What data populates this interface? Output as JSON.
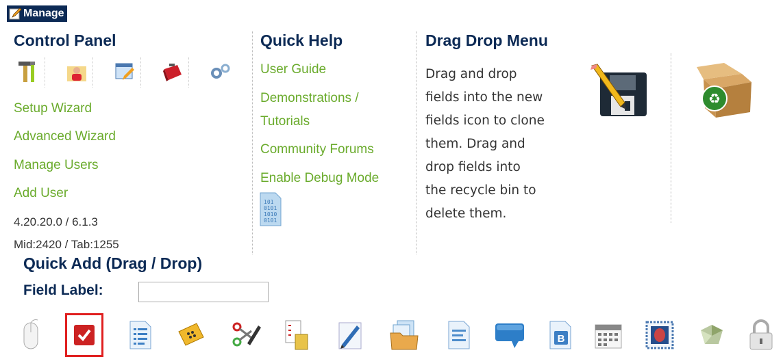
{
  "header": {
    "title": "Manage"
  },
  "control_panel": {
    "title": "Control Panel",
    "icons": [
      "tools-icon",
      "user-folder-icon",
      "window-edit-icon",
      "toolbox-icon",
      "gears-icon"
    ],
    "links": [
      "Setup Wizard",
      "Advanced Wizard",
      "Manage Users",
      "Add User"
    ],
    "version": "4.20.20.0 / 6.1.3",
    "ids": "Mid:2420 / Tab:1255"
  },
  "quick_help": {
    "title": "Quick Help",
    "links": {
      "user_guide": "User Guide",
      "demos_line1": "Demonstrations /",
      "demos_line2": "Tutorials",
      "forums": "Community Forums",
      "debug": "Enable Debug Mode"
    }
  },
  "drag_drop": {
    "title": "Drag Drop Menu",
    "lines": [
      "Drag and drop",
      "fields into the new",
      "fields icon to clone",
      "them. Drag and",
      "drop fields into",
      "the recycle bin to",
      "delete them."
    ]
  },
  "quick_add": {
    "title": "Quick Add (Drag / Drop)",
    "field_label": "Field Label:",
    "field_value": ""
  },
  "toolbar_icons": [
    "mouse-icon",
    "checkbox-icon",
    "list-doc-icon",
    "ticket-icon",
    "scissors-pen-icon",
    "checklist-doc-icon",
    "pencil-icon",
    "folder-doc-icon",
    "text-doc-icon",
    "speech-bubble-icon",
    "bold-doc-icon",
    "calendar-icon",
    "stamp-icon",
    "gem-icon",
    "lock-icon"
  ],
  "colors": {
    "heading": "#0c2a55",
    "link": "#6aab2c",
    "selection": "#e02020"
  }
}
